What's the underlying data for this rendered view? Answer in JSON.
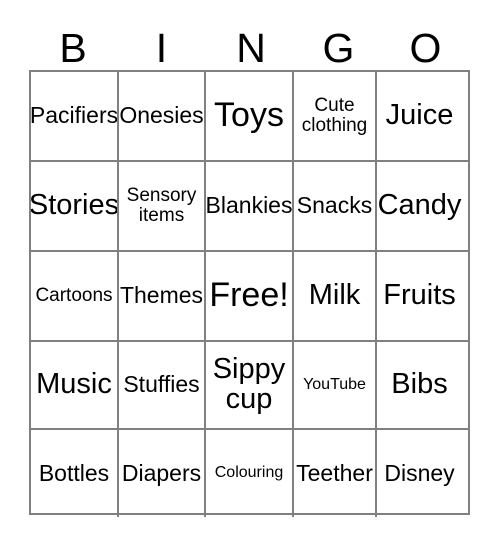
{
  "card": {
    "header_letters": [
      "B",
      "I",
      "N",
      "G",
      "O"
    ],
    "colors": {
      "grid_line": "#808080",
      "text": "#000000",
      "background": "#ffffff"
    },
    "rows": [
      [
        {
          "label": "Pacifiers",
          "size": "md"
        },
        {
          "label": "Onesies",
          "size": "md"
        },
        {
          "label": "Toys",
          "size": "xl"
        },
        {
          "label": "Cute clothing",
          "size": "sm"
        },
        {
          "label": "Juice",
          "size": "lg"
        }
      ],
      [
        {
          "label": "Stories",
          "size": "lg"
        },
        {
          "label": "Sensory items",
          "size": "sm"
        },
        {
          "label": "Blankies",
          "size": "md"
        },
        {
          "label": "Snacks",
          "size": "md"
        },
        {
          "label": "Candy",
          "size": "lg"
        }
      ],
      [
        {
          "label": "Cartoons",
          "size": "sm"
        },
        {
          "label": "Themes",
          "size": "md"
        },
        {
          "label": "Free!",
          "size": "xl"
        },
        {
          "label": "Milk",
          "size": "lg"
        },
        {
          "label": "Fruits",
          "size": "lg"
        }
      ],
      [
        {
          "label": "Music",
          "size": "lg"
        },
        {
          "label": "Stuffies",
          "size": "md"
        },
        {
          "label": "Sippy cup",
          "size": "lg"
        },
        {
          "label": "YouTube",
          "size": "xs"
        },
        {
          "label": "Bibs",
          "size": "lg"
        }
      ],
      [
        {
          "label": "Bottles",
          "size": "md"
        },
        {
          "label": "Diapers",
          "size": "md"
        },
        {
          "label": "Colouring",
          "size": "xs"
        },
        {
          "label": "Teether",
          "size": "md"
        },
        {
          "label": "Disney",
          "size": "md"
        }
      ]
    ]
  }
}
